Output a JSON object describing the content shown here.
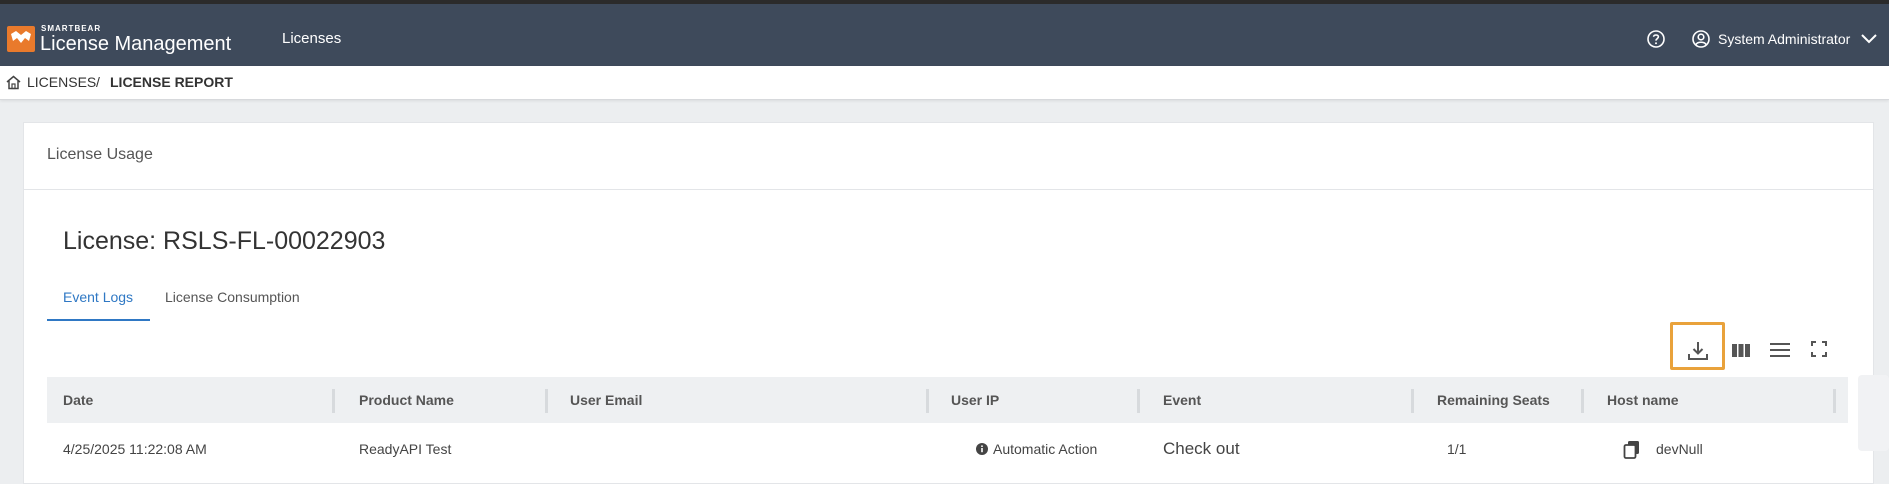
{
  "header": {
    "brand_small": "SMARTBEAR",
    "brand_title": "License Management",
    "nav_item": "Licenses",
    "user_name": "System Administrator",
    "icons": [
      "logo-icon",
      "help-icon",
      "user-icon",
      "chevron-down-icon"
    ]
  },
  "breadcrumb": {
    "items": [
      "LICENSES",
      "LICENSE REPORT"
    ],
    "separator": "/"
  },
  "card": {
    "title": "License Usage",
    "license_title": "License: RSLS-FL-00022903",
    "tabs": [
      "Event Logs",
      "License Consumption"
    ],
    "active_tab": "Event Logs",
    "toolbar_icons": [
      "download-icon",
      "columns-icon",
      "density-icon",
      "fullscreen-icon"
    ]
  },
  "table": {
    "columns": [
      "Date",
      "Product Name",
      "User Email",
      "User IP",
      "Event",
      "Remaining Seats",
      "Host name"
    ],
    "rows": [
      {
        "date": "4/25/2025 11:22:08 AM",
        "product": "ReadyAPI Test",
        "email": "",
        "ip": "Automatic Action",
        "event": "Check out",
        "seats": "1/1",
        "host": "devNull"
      }
    ]
  },
  "colors": {
    "navbar": "#3e4a5b",
    "accent": "#2f78c4",
    "brand_orange": "#e97a2c",
    "highlight": "#e9a23b"
  }
}
